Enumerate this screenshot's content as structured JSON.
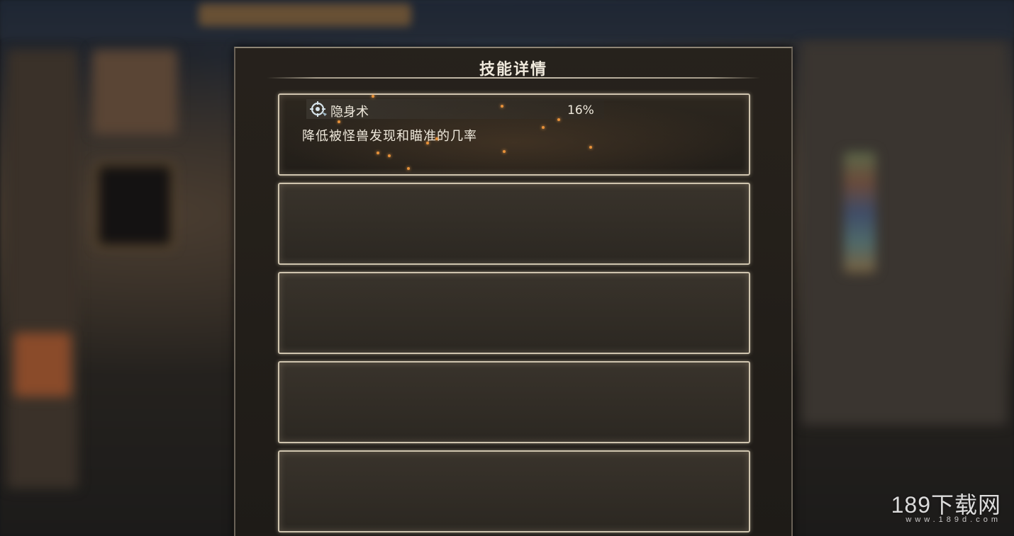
{
  "dialog": {
    "title": "技能详情"
  },
  "skills": [
    {
      "name": "隐身术",
      "percent": "16%",
      "description": "降低被怪兽发现和瞄准的几率",
      "icon": "crosshair-skill-icon"
    }
  ],
  "empty_slot_count": 4,
  "watermark": {
    "brand": "189下载网",
    "url": "www.189d.com"
  },
  "colors": {
    "panel_bg": "#26211b",
    "slot_border": "#cfc4ae",
    "text": "#efe9dc",
    "ember": "#e8923a"
  }
}
